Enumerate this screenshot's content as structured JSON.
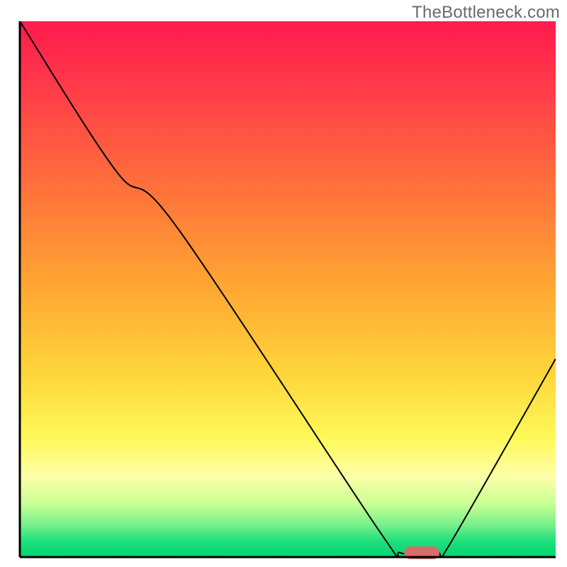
{
  "watermark_text": "TheBottleneck.com",
  "colors": {
    "axis": "#000000",
    "curve": "#000000",
    "marker": "#d56d6d",
    "watermark": "#6a6a6a"
  },
  "chart_data": {
    "type": "line",
    "title": "",
    "xlabel": "",
    "ylabel": "",
    "xlim": [
      0,
      100
    ],
    "ylim": [
      0,
      100
    ],
    "legend_position": "none",
    "grid": false,
    "background": "rainbow-vertical-gradient",
    "series": [
      {
        "name": "bottleneck-curve",
        "x": [
          0,
          18,
          29,
          67,
          71,
          78,
          80,
          100
        ],
        "values": [
          100,
          72,
          62,
          5,
          0.8,
          0.8,
          2,
          37
        ]
      }
    ],
    "annotations": [
      {
        "name": "optimal-marker",
        "x": 75,
        "y": 0.8,
        "shape": "pill",
        "color": "#d56d6d"
      }
    ]
  }
}
